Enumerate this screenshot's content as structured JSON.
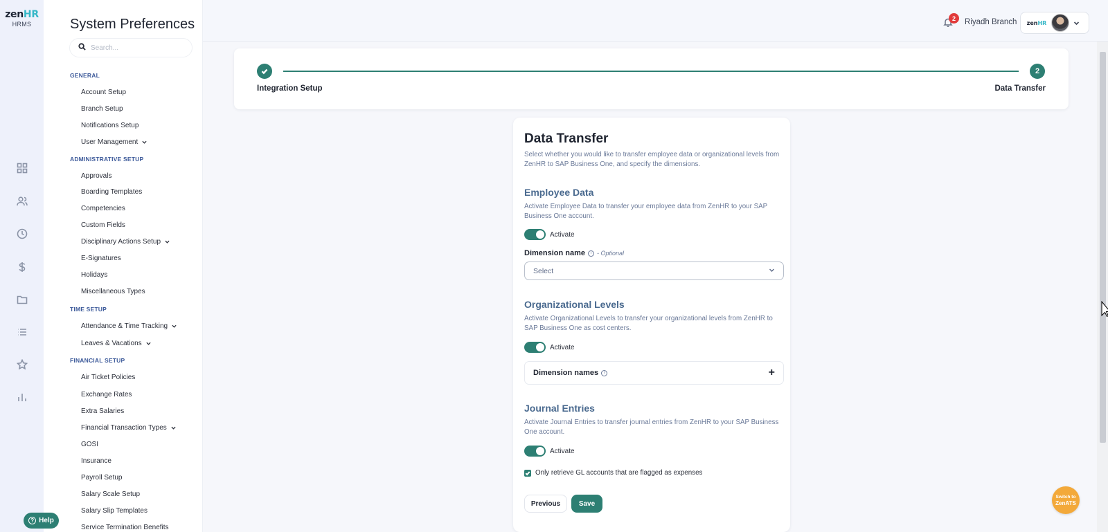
{
  "logo": {
    "brand_a": "zen",
    "brand_b": "HR",
    "sub": "HRMS"
  },
  "sidebar": {
    "title": "System Preferences",
    "search_placeholder": "Search...",
    "sections": {
      "general": "GENERAL",
      "administrative": "ADMINISTRATIVE SETUP",
      "time": "TIME SETUP",
      "financial": "FINANCIAL SETUP"
    },
    "items": [
      "Account Setup",
      "Branch Setup",
      "Notifications Setup",
      "User Management",
      "Approvals",
      "Boarding Templates",
      "Competencies",
      "Custom Fields",
      "Disciplinary Actions Setup",
      "E-Signatures",
      "Holidays",
      "Miscellaneous Types",
      "Attendance & Time Tracking",
      "Leaves & Vacations",
      "Air Ticket Policies",
      "Exchange Rates",
      "Extra Salaries",
      "Financial Transaction Types",
      "GOSI",
      "Insurance",
      "Payroll Setup",
      "Salary Scale Setup",
      "Salary Slip Templates",
      "Service Termination Benefits"
    ]
  },
  "rail_icons": [
    "dashboard-icon",
    "people-icon",
    "clock-icon",
    "dollar-icon",
    "folder-icon",
    "list-icon",
    "star-icon",
    "chart-icon"
  ],
  "help": {
    "label": "Help"
  },
  "header": {
    "notification_count": "2",
    "branch": "Riyadh Branch",
    "mini_logo_a": "zen",
    "mini_logo_b": "HR"
  },
  "stepper": {
    "step1_label": "Integration Setup",
    "step2_number": "2",
    "step2_label": "Data Transfer"
  },
  "form": {
    "title": "Data Transfer",
    "lead": "Select whether you would like to transfer employee data or organizational levels from ZenHR to SAP Business One, and specify the dimensions.",
    "employee": {
      "heading": "Employee Data",
      "desc": "Activate Employee Data to transfer your employee data from ZenHR to your SAP Business One account.",
      "toggle_label": "Activate",
      "dimension_label": "Dimension name",
      "optional": "- Optional",
      "select_value": "Select"
    },
    "org": {
      "heading": "Organizational Levels",
      "desc": "Activate Organizational Levels to transfer your organizational levels from ZenHR to SAP Business One as cost centers.",
      "toggle_label": "Activate",
      "dimension_names": "Dimension names",
      "add": "+"
    },
    "journal": {
      "heading": "Journal Entries",
      "desc": "Activate Journal Entries to transfer journal entries from ZenHR to your SAP Business One account.",
      "toggle_label": "Activate",
      "checkbox_label": "Only retrieve GL accounts that are flagged as expenses"
    },
    "previous": "Previous",
    "save": "Save"
  },
  "zenats": {
    "line1": "Switch to",
    "line2": "ZenATS"
  },
  "colors": {
    "accent": "#2d7f73",
    "badge": "#e23a3a",
    "zenats": "#f3a93a"
  }
}
